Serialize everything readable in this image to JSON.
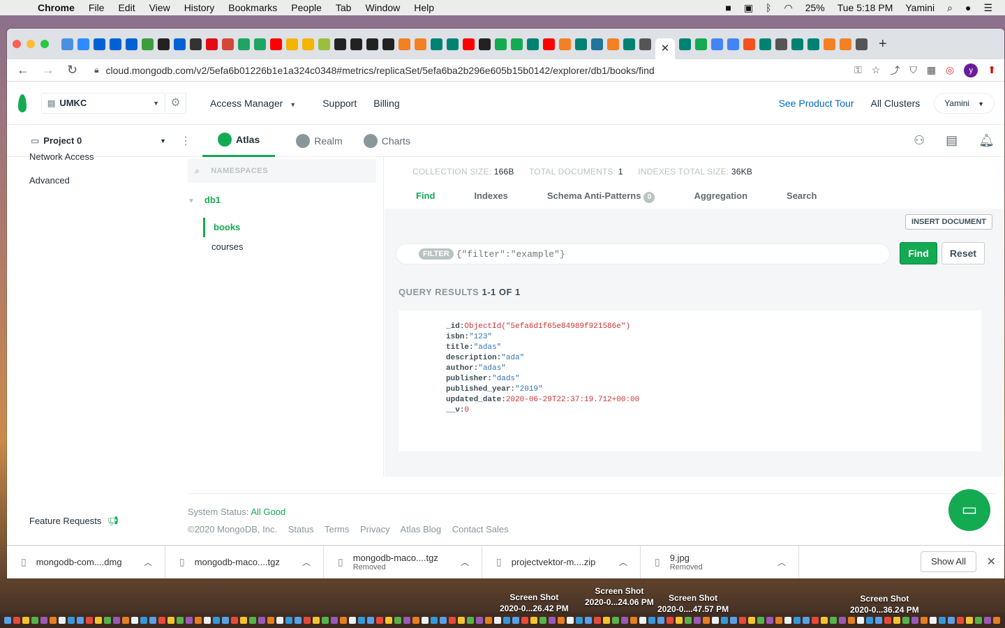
{
  "menubar": {
    "app": "Chrome",
    "items": [
      "File",
      "Edit",
      "View",
      "History",
      "Bookmarks",
      "People",
      "Tab",
      "Window",
      "Help"
    ],
    "battery": "25%",
    "clock": "Tue 5:18 PM",
    "user": "Yamini"
  },
  "browser": {
    "url": "cloud.mongodb.com/v2/5efa6b01226b1e1a324c0348#metrics/replicaSet/5efa6ba2b296e605b15b0142/explorer/db1/books/find",
    "profile_initial": "y"
  },
  "topnav": {
    "org": "UMKC",
    "access_manager": "Access Manager",
    "support": "Support",
    "billing": "Billing",
    "product_tour": "See Product Tour",
    "all_clusters": "All Clusters",
    "user": "Yamini"
  },
  "projnav": {
    "project": "Project 0",
    "tabs": [
      "Atlas",
      "Realm",
      "Charts"
    ]
  },
  "leftnav": {
    "cut_item": "Network Access",
    "advanced": "Advanced",
    "feature_requests": "Feature Requests"
  },
  "namespaces": {
    "placeholder": "NAMESPACES",
    "db": "db1",
    "collections": [
      "books",
      "courses"
    ]
  },
  "stats": {
    "coll_size_label": "COLLECTION SIZE:",
    "coll_size": "166B",
    "total_docs_label": "TOTAL DOCUMENTS:",
    "total_docs": "1",
    "indexes_label": "INDEXES TOTAL SIZE:",
    "indexes_size": "36KB"
  },
  "collection_tabs": {
    "find": "Find",
    "indexes": "Indexes",
    "schema": "Schema Anti-Patterns",
    "schema_badge": "0",
    "aggregation": "Aggregation",
    "search": "Search"
  },
  "query": {
    "insert": "INSERT DOCUMENT",
    "filter_label": "FILTER",
    "filter_placeholder": "{\"filter\":\"example\"}",
    "find": "Find",
    "reset": "Reset",
    "results_label": "QUERY RESULTS",
    "results_range": "1-1 OF 1"
  },
  "document": [
    {
      "key": "_id",
      "value": "ObjectId(\"5efa6d1f65e84989f921586e\")",
      "type": "o"
    },
    {
      "key": "isbn",
      "value": "\"123\"",
      "type": "s"
    },
    {
      "key": "title",
      "value": "\"adas\"",
      "type": "s"
    },
    {
      "key": "description",
      "value": "\"ada\"",
      "type": "s"
    },
    {
      "key": "author",
      "value": "\"adas\"",
      "type": "s"
    },
    {
      "key": "publisher",
      "value": "\"dads\"",
      "type": "s"
    },
    {
      "key": "published_year",
      "value": "\"2019\"",
      "type": "s"
    },
    {
      "key": "updated_date",
      "value": "2020-06-29T22:37:19.712+00:00",
      "type": "n"
    },
    {
      "key": "__v",
      "value": "0",
      "type": "n"
    }
  ],
  "footer": {
    "status_label": "System Status:",
    "status": "All Good",
    "links": [
      "©2020 MongoDB, Inc.",
      "Status",
      "Terms",
      "Privacy",
      "Atlas Blog",
      "Contact Sales"
    ]
  },
  "downloads": {
    "items": [
      {
        "name": "mongodb-com....dmg",
        "sub": ""
      },
      {
        "name": "mongodb-maco....tgz",
        "sub": ""
      },
      {
        "name": "mongodb-maco....tgz",
        "sub": "Removed"
      },
      {
        "name": "projectvektor-m....zip",
        "sub": ""
      },
      {
        "name": "9.jpg",
        "sub": "Removed"
      }
    ],
    "show_all": "Show All"
  },
  "desktop": {
    "screenshots": [
      {
        "line1": "Screen Shot",
        "line2": "2020-0...26.42 PM"
      },
      {
        "line1": "Screen Shot",
        "line2": "2020-0...24.06 PM"
      },
      {
        "line1": "Screen Shot",
        "line2": "2020-0....47.57 PM"
      },
      {
        "line1": "Screen Shot",
        "line2": "2020-0...36.24 PM"
      }
    ]
  },
  "colors": {
    "brand_green": "#13aa52",
    "link_blue": "#006cbc",
    "string_blue": "#3173b5",
    "objectid_red": "#d03232"
  }
}
